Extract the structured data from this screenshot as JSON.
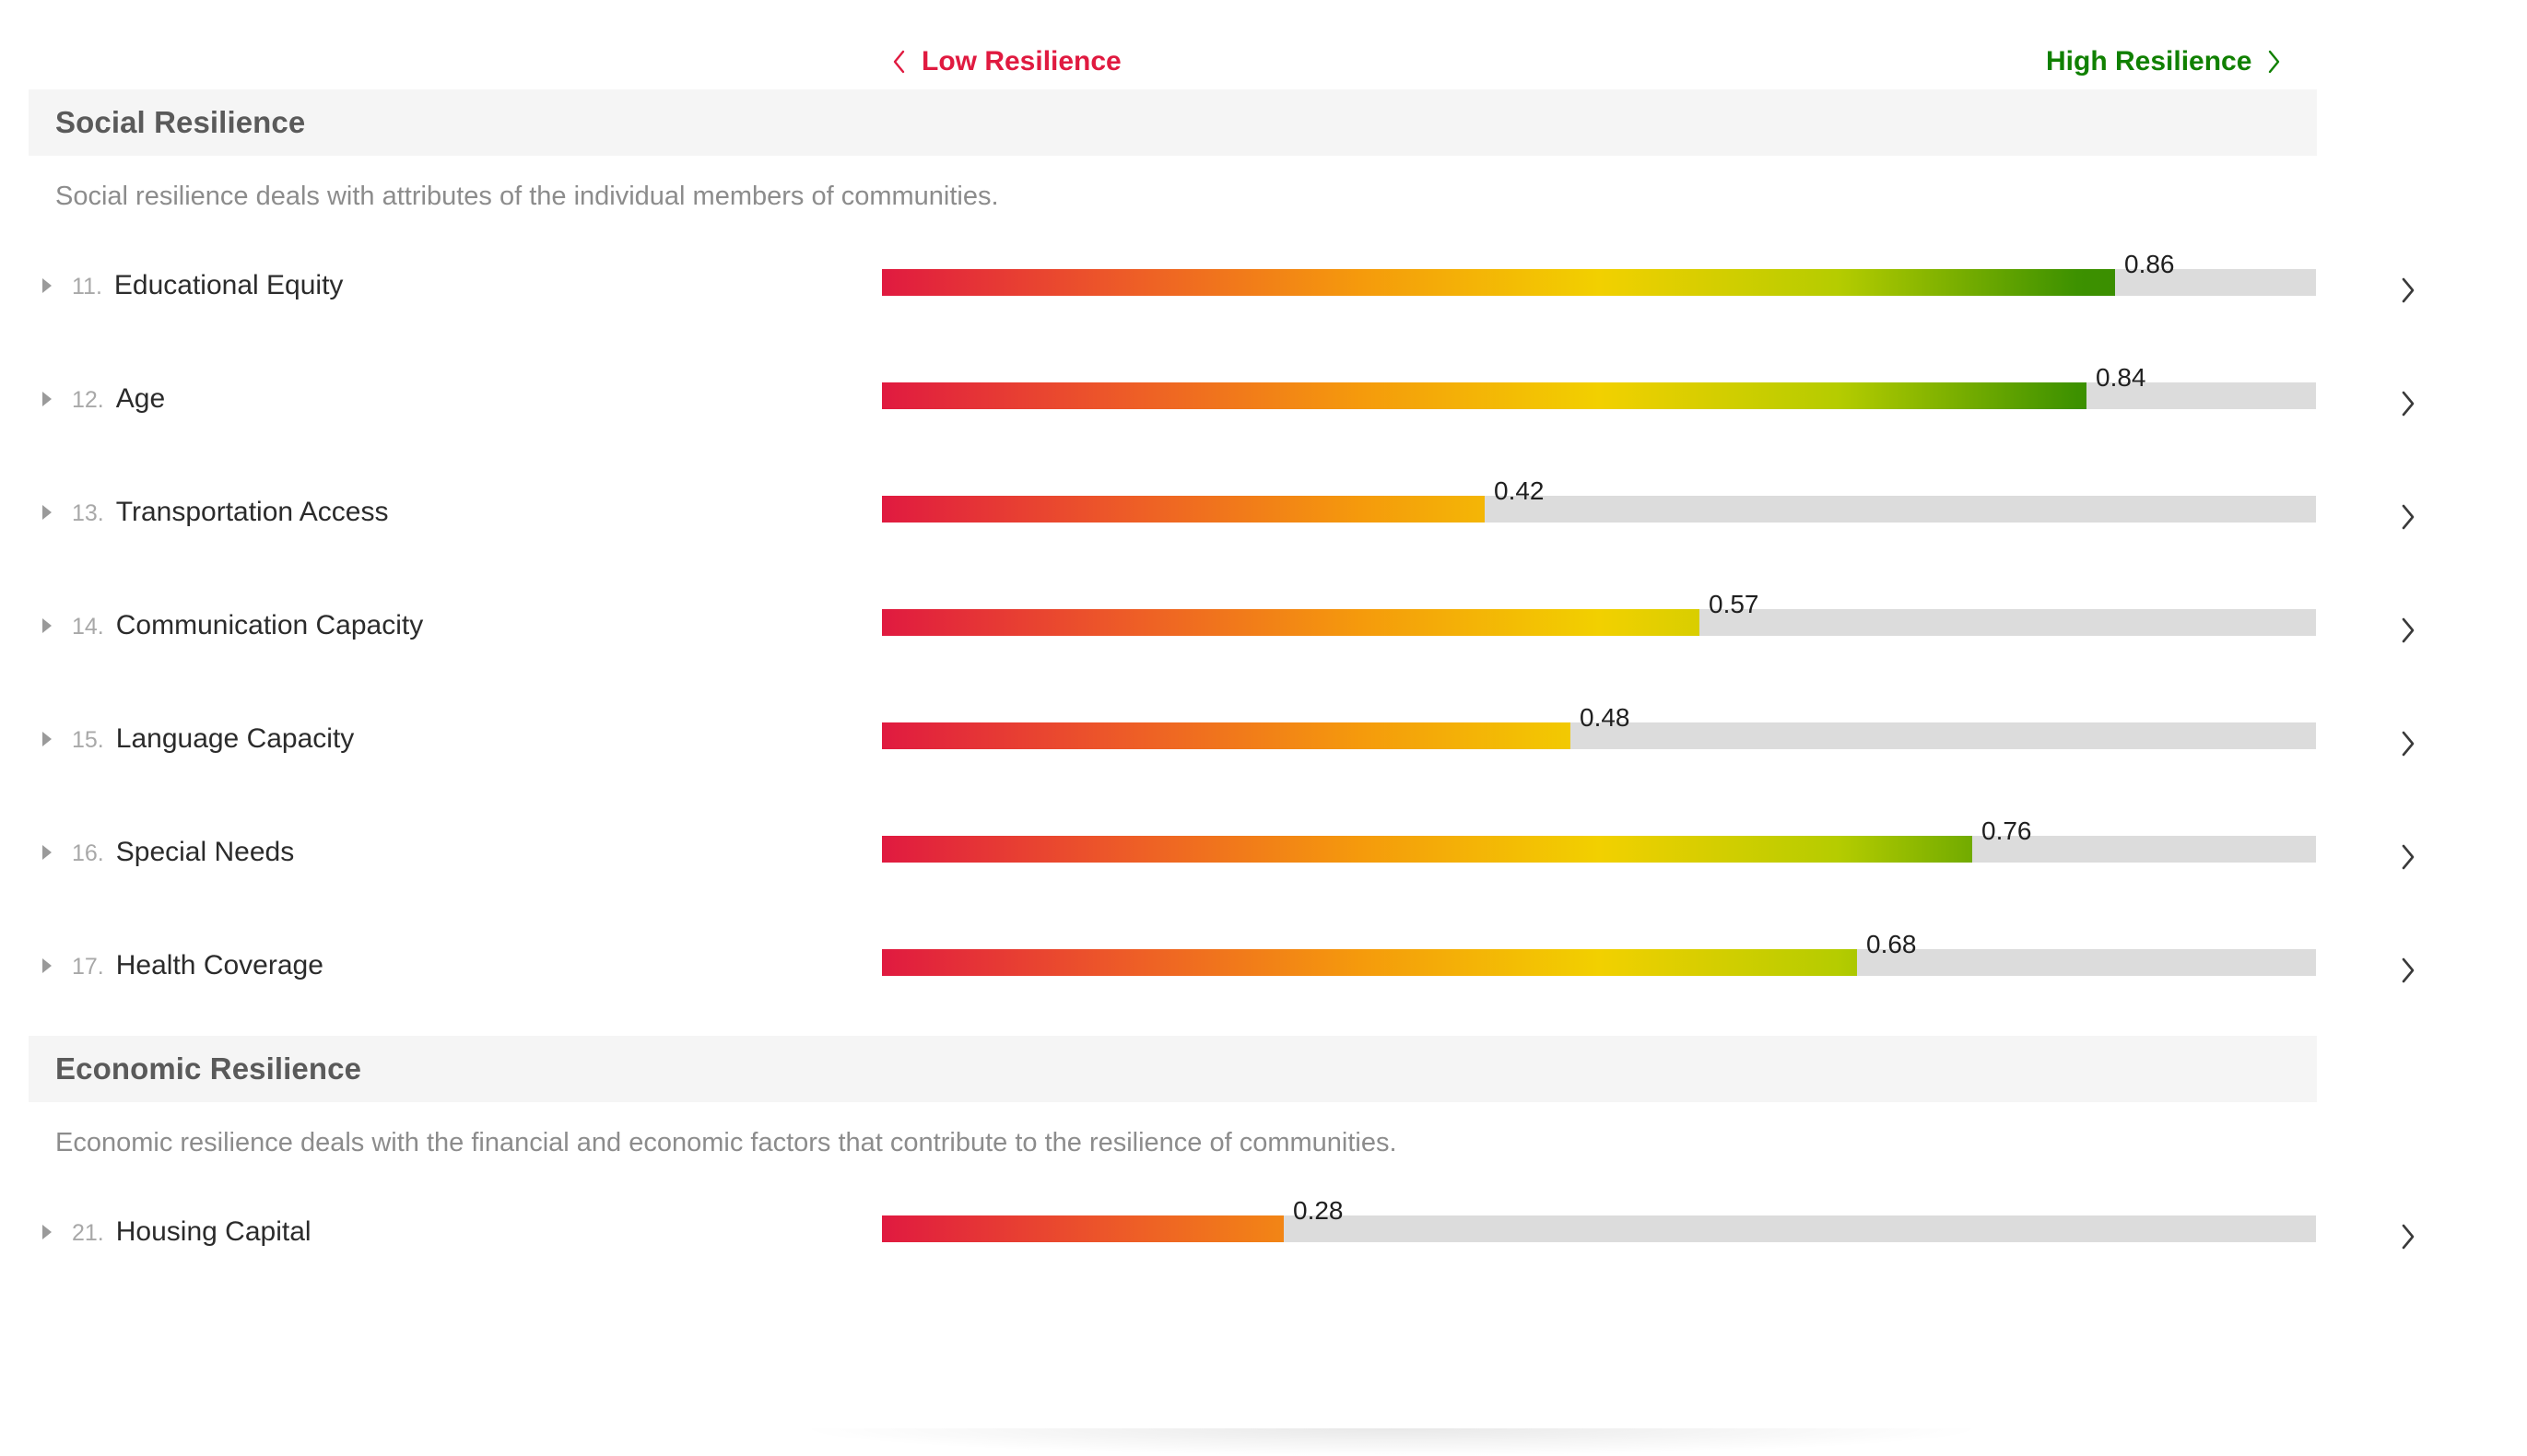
{
  "legend": {
    "low_label": "Low Resilience",
    "low_color": "#e01a40",
    "low_icon": "chevron-left-icon",
    "high_label": "High Resilience",
    "high_color": "#108000",
    "high_icon": "chevron-right-icon"
  },
  "scale": {
    "min": 0,
    "max": 1,
    "track_color": "#dcdcdc",
    "gradient_stops": [
      "#e01a40",
      "#ed5a28",
      "#f59a0c",
      "#f2d000",
      "#b5cc00",
      "#3d9100",
      "#2d8000"
    ]
  },
  "sections": [
    {
      "title": "Social Resilience",
      "description": "Social resilience deals with attributes of the individual members of communities.",
      "rows": [
        {
          "number": "11.",
          "name": "Educational Equity",
          "value": "0.86",
          "fraction": 0.86
        },
        {
          "number": "12.",
          "name": "Age",
          "value": "0.84",
          "fraction": 0.84
        },
        {
          "number": "13.",
          "name": "Transportation Access",
          "value": "0.42",
          "fraction": 0.42
        },
        {
          "number": "14.",
          "name": "Communication Capacity",
          "value": "0.57",
          "fraction": 0.57
        },
        {
          "number": "15.",
          "name": "Language Capacity",
          "value": "0.48",
          "fraction": 0.48
        },
        {
          "number": "16.",
          "name": "Special Needs",
          "value": "0.76",
          "fraction": 0.76
        },
        {
          "number": "17.",
          "name": "Health Coverage",
          "value": "0.68",
          "fraction": 0.68
        }
      ]
    },
    {
      "title": "Economic Resilience",
      "description": "Economic resilience deals with the financial and economic factors that contribute to the resilience of communities.",
      "rows": [
        {
          "number": "21.",
          "name": "Housing Capital",
          "value": "0.28",
          "fraction": 0.28
        }
      ]
    }
  ],
  "chart_data": {
    "type": "bar",
    "title": "",
    "xlabel": "",
    "ylabel": "",
    "xlim": [
      0,
      1
    ],
    "grid": false,
    "legend_position": "top",
    "orientation": "horizontal",
    "legend_entries": [
      "Low Resilience",
      "High Resilience"
    ],
    "categories": [
      "11. Educational Equity",
      "12. Age",
      "13. Transportation Access",
      "14. Communication Capacity",
      "15. Language Capacity",
      "16. Special Needs",
      "17. Health Coverage",
      "21. Housing Capital"
    ],
    "values": [
      0.86,
      0.84,
      0.42,
      0.57,
      0.48,
      0.76,
      0.68,
      0.28
    ],
    "groups": [
      {
        "name": "Social Resilience",
        "categories": [
          "11. Educational Equity",
          "12. Age",
          "13. Transportation Access",
          "14. Communication Capacity",
          "15. Language Capacity",
          "16. Special Needs",
          "17. Health Coverage"
        ],
        "values": [
          0.86,
          0.84,
          0.42,
          0.57,
          0.48,
          0.76,
          0.68
        ]
      },
      {
        "name": "Economic Resilience",
        "categories": [
          "21. Housing Capital"
        ],
        "values": [
          0.28
        ]
      }
    ]
  }
}
